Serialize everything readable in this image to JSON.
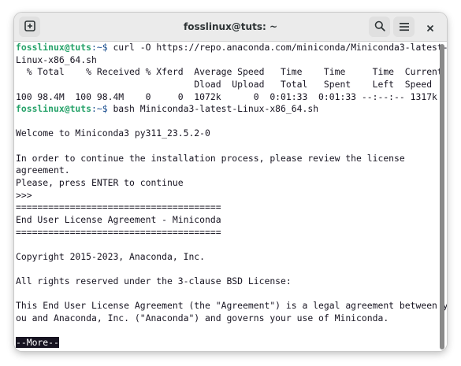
{
  "window": {
    "title": "fosslinux@tuts: ~"
  },
  "icons": {
    "new_tab": "new-tab-icon",
    "search": "search-icon",
    "menu": "hamburger-menu-icon",
    "close": "close-icon"
  },
  "colors": {
    "prompt_user": "#26a269",
    "prompt_path": "#12488b",
    "text": "#171421",
    "background": "#ffffff"
  },
  "terminal": {
    "prompt_user": "fosslinux@tuts",
    "prompt_path": ":~$ ",
    "cmd1_part1": "curl -O https://repo.anaconda.com/miniconda/Miniconda3-latest-",
    "cmd1_part2": "Linux-x86_64.sh",
    "curl_header1": "  % Total    % Received % Xferd  Average Speed   Time    Time     Time  Current",
    "curl_header2": "                                 Dload  Upload   Total   Spent    Left  Speed",
    "curl_progress": "100 98.4M  100 98.4M    0     0  1072k      0  0:01:33  0:01:33 --:--:-- 1317k",
    "cmd2": "bash Miniconda3-latest-Linux-x86_64.sh",
    "welcome": "Welcome to Miniconda3 py311_23.5.2-0",
    "review1": "In order to continue the installation process, please review the license",
    "review2": "agreement.",
    "press_enter": "Please, press ENTER to continue",
    "input_prompt": ">>>",
    "separator": "======================================",
    "eula_title": "End User License Agreement - Miniconda",
    "copyright": "Copyright 2015-2023, Anaconda, Inc.",
    "rights": "All rights reserved under the 3-clause BSD License:",
    "eula1": "This End User License Agreement (the \"Agreement\") is a legal agreement between y",
    "eula2": "ou and Anaconda, Inc. (\"Anaconda\") and governs your use of Miniconda.",
    "more": "--More--"
  }
}
